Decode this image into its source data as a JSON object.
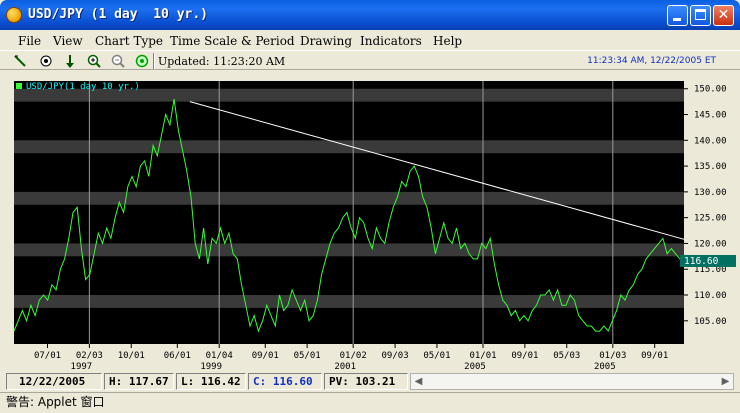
{
  "window": {
    "title": "USD/JPY (1 day  10 yr.)"
  },
  "menu": [
    "File",
    "View",
    "Chart Type",
    "Time Scale & Period",
    "Drawing",
    "Indicators",
    "Help"
  ],
  "toolbar": {
    "tools": [
      "draw-line-icon",
      "target-icon",
      "down-arrow-icon",
      "zoom-in-icon",
      "zoom-out-icon",
      "refresh-icon"
    ],
    "updated": "Updated: 11:23:20 AM",
    "timestamp": "11:23:34 AM, 12/22/2005 ET"
  },
  "status": {
    "date": "12/22/2005",
    "high": "H: 117.67",
    "low": "L: 116.42",
    "close": "C: 116.60",
    "pv": "PV: 103.21"
  },
  "warning": "警告: Applet 窗口",
  "chart_data": {
    "type": "line",
    "legend": "USD/JPY(1 day  10 yr.)",
    "last_value_label": "116.60",
    "y_ticks": [
      "150.00",
      "145.00",
      "140.00",
      "135.00",
      "130.00",
      "125.00",
      "120.00",
      "115.00",
      "110.00",
      "105.00"
    ],
    "ylim": [
      100.5,
      151.5
    ],
    "x_ticks": [
      {
        "label": "07/01",
        "sub": ""
      },
      {
        "label": "02/03",
        "sub": "1997"
      },
      {
        "label": "10/01",
        "sub": ""
      },
      {
        "label": "06/01",
        "sub": ""
      },
      {
        "label": "01/04",
        "sub": "1999"
      },
      {
        "label": "09/01",
        "sub": ""
      },
      {
        "label": "05/01",
        "sub": ""
      },
      {
        "label": "01/02",
        "sub": "2001"
      },
      {
        "label": "09/03",
        "sub": ""
      },
      {
        "label": "05/01",
        "sub": ""
      },
      {
        "label": "01/01",
        "sub": "2005"
      },
      {
        "label": "09/01",
        "sub": ""
      },
      {
        "label": "05/03",
        "sub": ""
      },
      {
        "label": "01/03",
        "sub": "2005"
      },
      {
        "label": "09/01",
        "sub": ""
      }
    ],
    "x_index_range": [
      0,
      160
    ],
    "tick_positions": [
      8,
      18,
      28,
      39,
      49,
      60,
      70,
      81,
      91,
      101,
      112,
      122,
      132,
      143,
      153
    ],
    "year_lines": [
      18,
      49,
      81,
      112,
      143
    ],
    "trendline": [
      {
        "x": 42,
        "y": 147.5
      },
      {
        "x": 160,
        "y": 120.8
      }
    ],
    "series": [
      {
        "color": "#33ff33",
        "values": [
          103,
          105,
          107,
          105,
          108,
          106,
          109,
          110,
          109,
          112,
          111,
          115,
          117,
          121,
          126,
          127,
          119,
          113,
          114,
          118,
          122,
          120,
          123,
          121,
          125,
          128,
          126,
          131,
          133,
          131,
          135,
          136,
          133,
          139,
          137,
          141,
          145,
          143,
          148,
          142,
          138,
          134,
          129,
          120,
          117,
          123,
          116,
          121,
          120,
          123,
          120,
          122,
          118,
          117,
          112,
          108,
          104,
          106,
          103,
          105,
          108,
          106,
          104,
          110,
          107,
          108,
          111,
          109,
          107,
          109,
          105,
          106,
          109,
          114,
          117,
          120,
          122,
          123,
          125,
          126,
          123,
          121,
          125,
          124,
          121,
          119,
          123,
          121,
          120,
          124,
          127,
          129,
          132,
          131,
          134,
          135,
          133,
          129,
          127,
          123,
          118,
          121,
          124,
          121,
          120,
          123,
          119,
          120,
          118,
          117,
          117,
          120,
          119,
          121,
          116,
          112,
          109,
          108,
          106,
          107,
          105,
          106,
          105,
          107,
          108,
          110,
          110,
          111,
          109,
          111,
          108,
          108,
          110,
          109,
          106,
          105,
          104,
          104,
          103,
          103,
          104,
          103,
          105,
          107,
          110,
          109,
          111,
          112,
          114,
          115,
          117,
          118,
          119,
          120,
          121,
          118,
          119,
          118,
          117,
          117
        ]
      }
    ]
  }
}
